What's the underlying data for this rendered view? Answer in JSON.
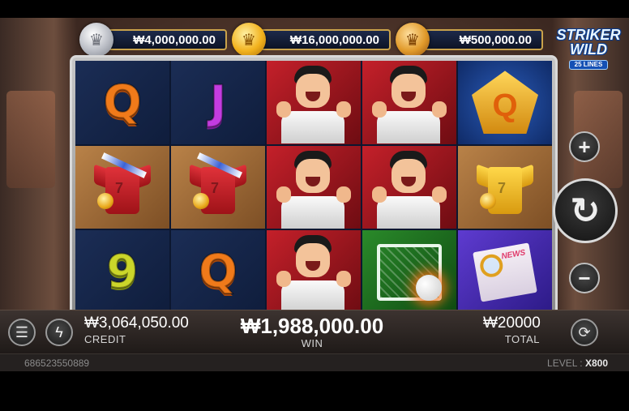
{
  "game": {
    "logo_line1": "STRIKER",
    "logo_line2": "WILD",
    "logo_lines": "25 LINES"
  },
  "jackpots": [
    {
      "tier": "silver",
      "icon": "crown-medal-icon",
      "amount": "₩4,000,000.00"
    },
    {
      "tier": "gold",
      "icon": "crown-medal-icon",
      "amount": "₩16,000,000.00"
    },
    {
      "tier": "bronze",
      "icon": "crown-medal-icon",
      "amount": "₩500,000.00"
    }
  ],
  "reels": {
    "symbols": [
      [
        "Q",
        "J",
        "player",
        "player",
        "Q-pentagon"
      ],
      [
        "jersey-red",
        "jersey-red",
        "player",
        "player",
        "jersey-gold"
      ],
      [
        "9",
        "Q",
        "player",
        "wild-goal",
        "news"
      ]
    ],
    "news_text": "NEWS",
    "jersey_number": "7"
  },
  "controls": {
    "bet_increase_icon": "plus-icon",
    "bet_decrease_icon": "minus-icon",
    "spin_icon": "refresh-arrow-icon",
    "plus_glyph": "+",
    "minus_glyph": "−",
    "spin_glyph": "↻"
  },
  "bottom_bar": {
    "menu_glyph": "☰",
    "turbo_glyph": "ϟ",
    "autoplay_glyph": "⟳",
    "credit_value": "₩3,064,050.00",
    "credit_label": "CREDIT",
    "win_value": "₩1,988,000.00",
    "win_label": "WIN",
    "total_value": "₩20000",
    "total_label": "TOTAL"
  },
  "footer": {
    "session_id": "686523550889",
    "level_label": "LEVEL :",
    "level_value": "X800"
  },
  "colors": {
    "accent_gold": "#c9a24a",
    "q_orange": "#f07a1a",
    "j_purple": "#c43ce0",
    "nine_yellow": "#cbd62a",
    "player_red": "#c4202a"
  }
}
